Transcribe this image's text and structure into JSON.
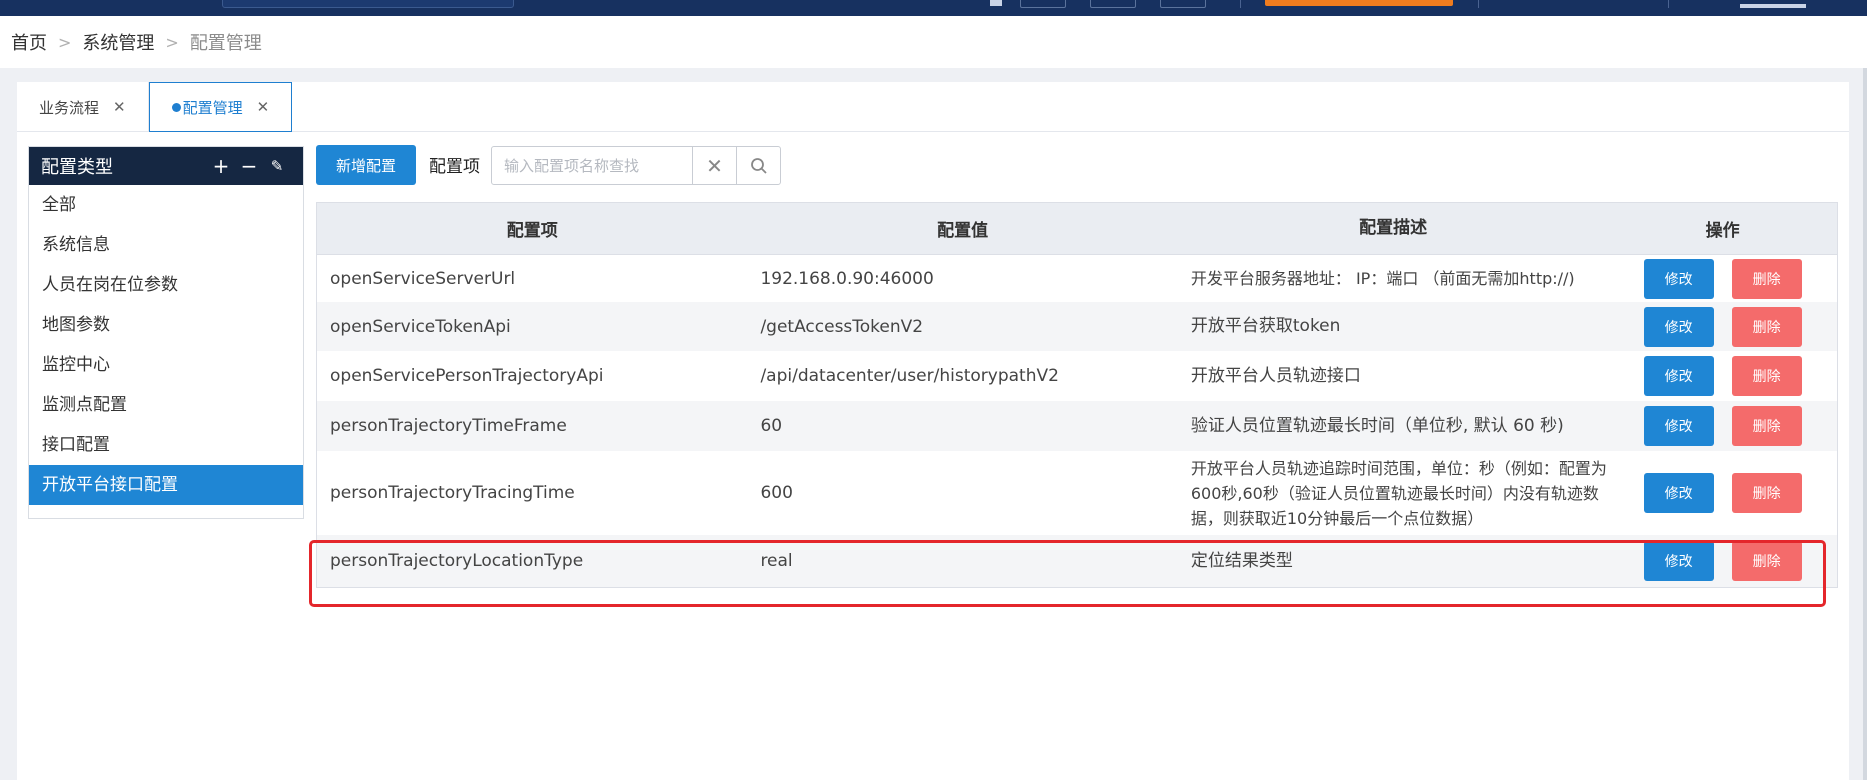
{
  "breadcrumb": [
    "首页",
    "系统管理",
    "配置管理"
  ],
  "tabs": [
    {
      "label": "业务流程",
      "active": false
    },
    {
      "label": "配置管理",
      "active": true
    }
  ],
  "tree": {
    "title": "配置类型",
    "add_icon": "plus-icon",
    "remove_icon": "minus-icon",
    "edit_icon": "pencil-icon",
    "items": [
      "全部",
      "系统信息",
      "人员在岗在位参数",
      "地图参数",
      "监控中心",
      "监测点配置",
      "接口配置",
      "开放平台接口配置"
    ],
    "selected": "开放平台接口配置"
  },
  "toolbar": {
    "add_label": "新增配置",
    "filter_label": "配置项",
    "search_placeholder": "输入配置项名称查找",
    "search_value": ""
  },
  "table": {
    "headers": [
      "配置项",
      "配置值",
      "配置描述",
      "操作"
    ],
    "edit_label": "修改",
    "delete_label": "删除",
    "rows": [
      {
        "key": "openServiceServerUrl",
        "value": "192.168.0.90:46000",
        "desc": "开发平台服务器地址： IP：端口 （前面无需加http://)"
      },
      {
        "key": "openServiceTokenApi",
        "value": "/getAccessTokenV2",
        "desc": "开放平台获取token"
      },
      {
        "key": "openServicePersonTrajectoryApi",
        "value": "/api/datacenter/user/historypathV2",
        "desc": "开放平台人员轨迹接口"
      },
      {
        "key": "personTrajectoryTimeFrame",
        "value": "60",
        "desc": "验证人员位置轨迹最长时间（单位秒, 默认 60 秒)"
      },
      {
        "key": "personTrajectoryTracingTime",
        "value": "600",
        "desc": "开放平台人员轨迹追踪时间范围，单位：秒（例如：配置为600秒,60秒（验证人员位置轨迹最长时间）内没有轨迹数据，则获取近10分钟最后一个点位数据）"
      },
      {
        "key": "personTrajectoryLocationType",
        "value": "real",
        "desc": "定位结果类型"
      }
    ]
  },
  "colors": {
    "topbar": "#173160",
    "primary": "#1f86d4",
    "danger": "#f46b6b",
    "tree_header": "#152742",
    "highlight": "#e4262b"
  }
}
